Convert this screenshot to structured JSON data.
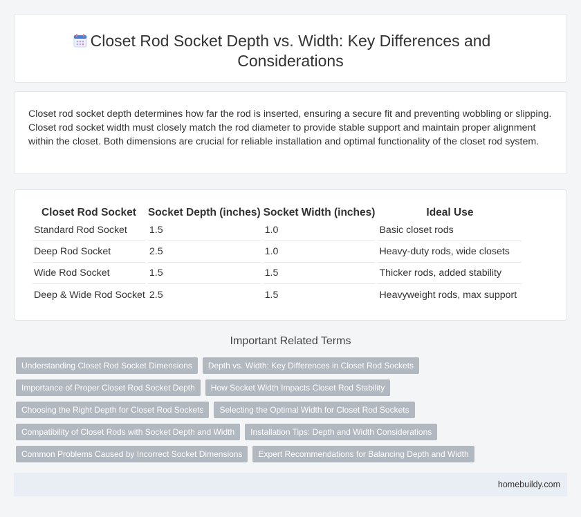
{
  "header": {
    "title": "Closet Rod Socket Depth vs. Width: Key Differences and Considerations",
    "icon": "calendar-icon"
  },
  "intro": {
    "text": "Closet rod socket depth determines how far the rod is inserted, ensuring a secure fit and preventing wobbling or slipping. Closet rod socket width must closely match the rod diameter to provide stable support and maintain proper alignment within the closet. Both dimensions are crucial for reliable installation and optimal functionality of the closet rod system."
  },
  "table": {
    "headers": [
      "Closet Rod Socket",
      "Socket Depth (inches)",
      "Socket Width (inches)",
      "Ideal Use"
    ],
    "rows": [
      [
        "Standard Rod Socket",
        "1.5",
        "1.0",
        "Basic closet rods"
      ],
      [
        "Deep Rod Socket",
        "2.5",
        "1.0",
        "Heavy-duty rods, wide closets"
      ],
      [
        "Wide Rod Socket",
        "1.5",
        "1.5",
        "Thicker rods, added stability"
      ],
      [
        "Deep & Wide Rod Socket",
        "2.5",
        "1.5",
        "Heavyweight rods, max support"
      ]
    ]
  },
  "related": {
    "heading": "Important Related Terms",
    "tags": [
      [
        "Understanding Closet Rod Socket Dimensions",
        "Depth vs. Width: Key Differences in Closet Rod Sockets"
      ],
      [
        "Importance of Proper Closet Rod Socket Depth",
        "How Socket Width Impacts Closet Rod Stability"
      ],
      [
        "Choosing the Right Depth for Closet Rod Sockets",
        "Selecting the Optimal Width for Closet Rod Sockets"
      ],
      [
        "Compatibility of Closet Rods with Socket Depth and Width",
        "Installation Tips: Depth and Width Considerations"
      ],
      [
        "Common Problems Caused by Incorrect Socket Dimensions",
        "Expert Recommendations for Balancing Depth and Width"
      ]
    ]
  },
  "footer": {
    "site": "homebuildy.com"
  },
  "colors": {
    "tag_bg": "#b2b8bf",
    "footer_bg": "#e9eef5",
    "icon_blue": "#4a7fd6",
    "icon_pink": "#e77ea6"
  }
}
